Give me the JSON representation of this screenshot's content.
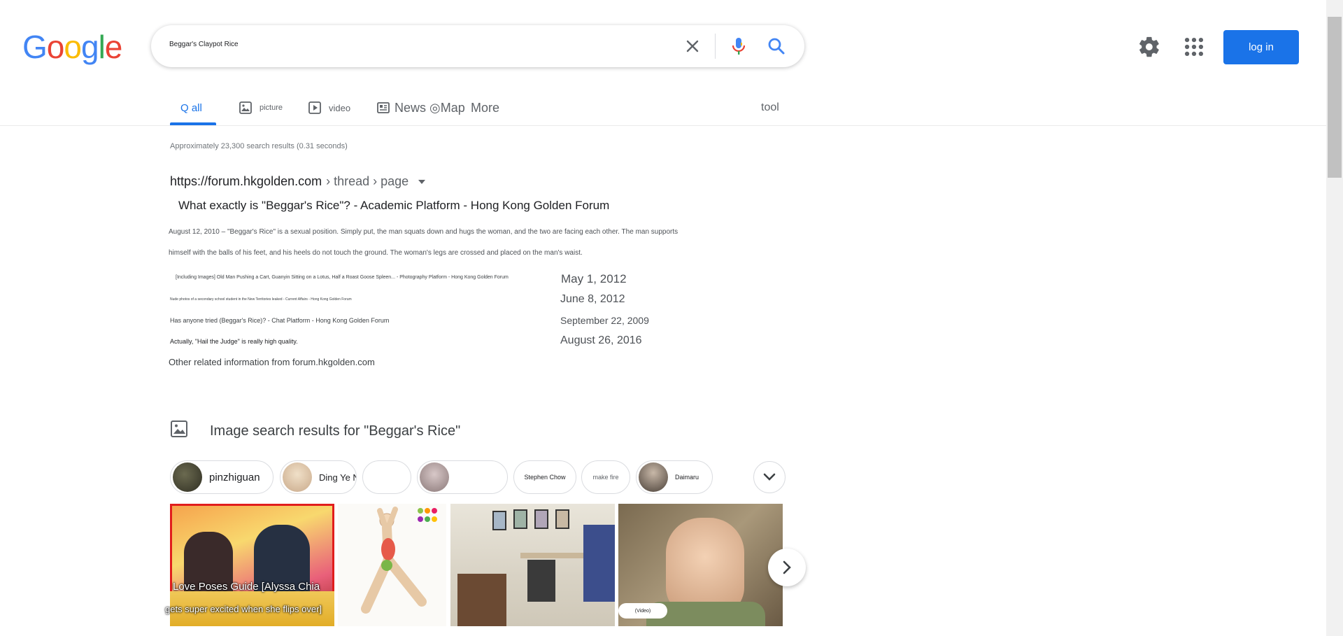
{
  "logo": {
    "letters": [
      "G",
      "o",
      "o",
      "g",
      "l",
      "e"
    ],
    "colors": [
      "#4285f4",
      "#ea4335",
      "#fbbc05",
      "#4285f4",
      "#34a853",
      "#ea4335"
    ]
  },
  "search": {
    "query": "Beggar's Claypot Rice"
  },
  "header": {
    "login_label": "log in"
  },
  "tabs": {
    "all": "Q all",
    "picture": "picture",
    "video": "video",
    "news": "News",
    "map": "◎Map",
    "more": "More",
    "tool": "tool"
  },
  "stats": "Approximately 23,300 search results (0.31 seconds)",
  "result": {
    "cite_domain": "https://forum.hkgolden.com",
    "cite_path": "› thread › page",
    "title": "What exactly is \"Beggar's Rice\"? - Academic Platform - Hong Kong Golden Forum",
    "snippet_line1": "August 12, 2010 – \"Beggar's Rice\" is a sexual position. Simply put, the man squats down and hugs the woman, and the two are facing each other. The man supports",
    "snippet_line2": "himself with the balls of his feet, and his heels do not touch the ground. The woman's legs are crossed and placed on the man's waist.",
    "sublinks": [
      {
        "text": "[Including Images] Old Man Pushing a Cart, Guanyin Sitting on a Lotus, Half a Roast Goose Spleen... - Photography Platform - Hong Kong Golden Forum",
        "date": "May 1, 2012"
      },
      {
        "text": "Nude photos of a secondary school student in the New Territories leaked - Current Affairs - Hong Kong Golden Forum",
        "date": "June 8, 2012"
      },
      {
        "text": "Has anyone tried (Beggar's Rice)? - Chat Platform - Hong Kong Golden Forum",
        "date": "September 22, 2009"
      },
      {
        "text": "Actually, \"Hail the Judge\" is really high quality.",
        "date": "August 26, 2016"
      }
    ],
    "other_info": "Other related information from forum.hkgolden.com"
  },
  "images": {
    "heading": "Image search results for \"Beggar's Rice\"",
    "chips": [
      {
        "label": "pinzhiguan",
        "thumb_color": "#4a4a3a"
      },
      {
        "label": "Ding Ye Ninth Grade",
        "thumb_color": "#d8c8b0"
      },
      {
        "label": "",
        "thumb_color": ""
      },
      {
        "label": "",
        "thumb_color": "#b8a8a8"
      },
      {
        "label": "Stephen Chow",
        "thumb_color": ""
      },
      {
        "label": "make fire",
        "thumb_color": ""
      },
      {
        "label": "Daimaru",
        "thumb_color": "#6a6058"
      }
    ],
    "tiles": [
      {
        "caption1": "Love Poses Guide [Alyssa Chia",
        "caption2": "gets super excited when she flips over]"
      },
      {
        "caption1": ""
      },
      {
        "caption1": ""
      },
      {
        "caption1": "(Video)"
      }
    ]
  }
}
